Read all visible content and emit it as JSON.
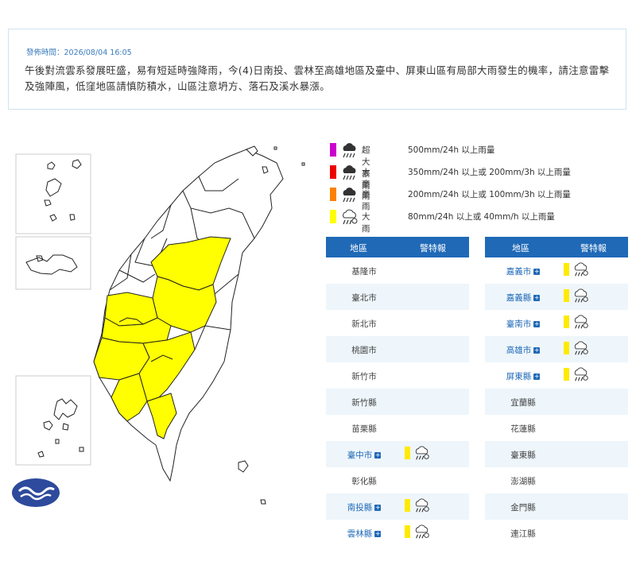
{
  "notice": {
    "time": "發佈時間：2026/08/04 16:05",
    "message": "午後對流雲系發展旺盛，易有短延時強降雨，今(4)日南投、雲林至高雄地區及臺中、屏東山區有局部大雨發生的機率，請注意雷擊及強陣風，低窪地區請慎防積水，山區注意坍方、落石及溪水暴漲。"
  },
  "legend": [
    {
      "name": "超大豪雨",
      "threshold": "500mm/24h 以上雨量",
      "color": "#cc00cc"
    },
    {
      "name": "大豪雨",
      "threshold": "350mm/24h 以上或 200mm/3h 以上雨量",
      "color": "#ee0000"
    },
    {
      "name": "豪雨",
      "threshold": "200mm/24h 以上或 100mm/3h 以上雨量",
      "color": "#ff8000"
    },
    {
      "name": "大雨",
      "threshold": "80mm/24h 以上或 40mm/h 以上雨量",
      "color": "#ffff00"
    }
  ],
  "table": {
    "col_area": "地區",
    "col_warning": "警特報",
    "left": [
      {
        "area": "基隆市",
        "warn": false
      },
      {
        "area": "臺北市",
        "warn": false
      },
      {
        "area": "新北市",
        "warn": false
      },
      {
        "area": "桃園市",
        "warn": false
      },
      {
        "area": "新竹市",
        "warn": false
      },
      {
        "area": "新竹縣",
        "warn": false
      },
      {
        "area": "苗栗縣",
        "warn": false
      },
      {
        "area": "臺中市",
        "warn": true
      },
      {
        "area": "彰化縣",
        "warn": false
      },
      {
        "area": "南投縣",
        "warn": true
      },
      {
        "area": "雲林縣",
        "warn": true
      }
    ],
    "right": [
      {
        "area": "嘉義市",
        "warn": true
      },
      {
        "area": "嘉義縣",
        "warn": true
      },
      {
        "area": "臺南市",
        "warn": true
      },
      {
        "area": "高雄市",
        "warn": true
      },
      {
        "area": "屏東縣",
        "warn": true
      },
      {
        "area": "宜蘭縣",
        "warn": false
      },
      {
        "area": "花蓮縣",
        "warn": false
      },
      {
        "area": "臺東縣",
        "warn": false
      },
      {
        "area": "澎湖縣",
        "warn": false
      },
      {
        "area": "金門縣",
        "warn": false
      },
      {
        "area": "連江縣",
        "warn": false
      }
    ]
  },
  "colors": {
    "accent": "#1f69b7",
    "heavy_rain": "#ffff00"
  },
  "icons": {
    "rain": "rain-cloud-icon",
    "logo": "cwa-logo-icon"
  }
}
